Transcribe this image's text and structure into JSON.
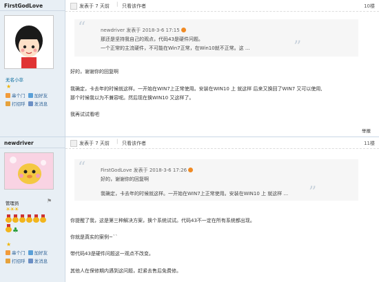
{
  "posts": [
    {
      "username": "FirstGodLove",
      "rank": "无名小卒",
      "side_links": {
        "chuanmen": "串个门",
        "add_friend": "加好友",
        "greet": "打招呼",
        "message": "发消息"
      },
      "header": {
        "posted": "发表于 7 天前",
        "only_author": "只看该作者",
        "floor": "10楼"
      },
      "quote": {
        "meta_user": "newdriver",
        "meta_time": "发表于 2018-3-6 17:15",
        "lines": [
          "那还是坚持我自己的观点，代码43是硬件问题。",
          "一个正常的主流硬件，不可能在Win7正常，在Win10就不正常。这 ..."
        ]
      },
      "body": [
        "好的，谢谢你的回复啊",
        "我确定，卡去年的时候就这样。一开始在WIN7上正常使用。安装在WIN10 上 就这样   后来又换回了WIN7 又可以使用,",
        "那个时候我以为不兼容呢。然后现在换WIN10 又这样了。",
        "我再试试看吧"
      ],
      "report": "举报"
    },
    {
      "username": "newdriver",
      "rank": "管理员",
      "side_links": {
        "chuanmen": "串个门",
        "add_friend": "加好友",
        "greet": "打招呼",
        "message": "发消息"
      },
      "header": {
        "posted": "发表于 7 天前",
        "only_author": "只看该作者",
        "floor": "11楼"
      },
      "quote": {
        "meta_user": "FirstGodLove",
        "meta_time": "发表于 2018-3-6 17:26",
        "lines": [
          "好的，谢谢你的回复啊",
          "我确定，卡去年的时候就这样。一开始在WIN7上正常使用。安装在WIN10 上 就这样 ..."
        ]
      },
      "body": [
        "你提醒了我，这是第三种解决方案，换个系统试试。代码43不一定在所有系统都出现。",
        "你就是真实的案例~``",
        "带代码43是硬件问题这一观点不改变。",
        "其他人在保修期内遇到这问题，赶紧去售后免费修。"
      ]
    }
  ],
  "colors": {
    "sidebar_bg": "#e8eff5",
    "link": "#336699",
    "quote_bg": "#f6f6f6"
  }
}
